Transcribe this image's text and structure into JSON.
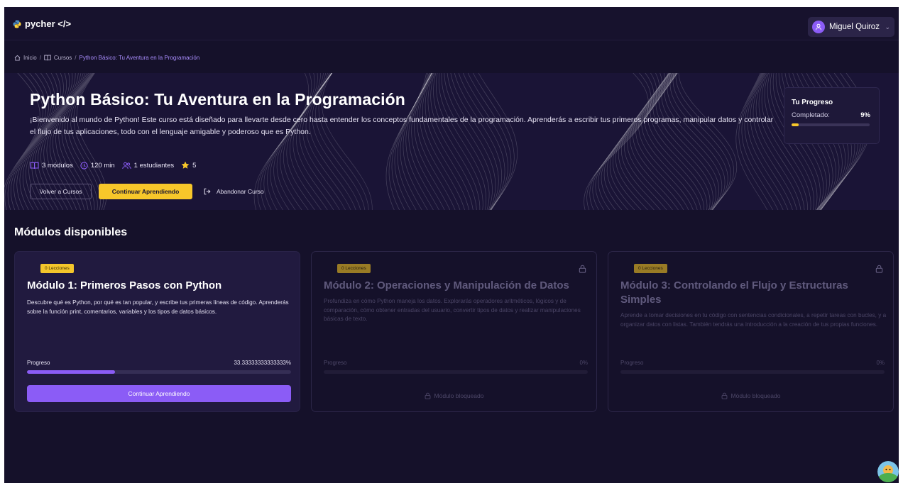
{
  "header": {
    "logo_text": "pycher </>",
    "user_name": "Miguel Quiroz"
  },
  "breadcrumb": {
    "home": "Inicio",
    "courses": "Cursos",
    "current": "Python Básico: Tu Aventura en la Programación",
    "separator": "/"
  },
  "hero": {
    "title": "Python Básico: Tu Aventura en la Programación",
    "description": "¡Bienvenido al mundo de Python! Este curso está diseñado para llevarte desde cero hasta entender los conceptos fundamentales de la programación. Aprenderás a escribir tus primeros programas, manipular datos y controlar el flujo de tus aplicaciones, todo con el lenguaje amigable y poderoso que es Python.",
    "stats": {
      "modules": "3 módulos",
      "duration": "120 min",
      "students": "1 estudiantes",
      "rating": "5"
    },
    "back_button": "Volver a Cursos",
    "continue_button": "Continuar Aprendiendo",
    "abandon_button": "Abandonar Curso"
  },
  "progress_card": {
    "title": "Tu Progreso",
    "label": "Completado:",
    "value": "9%",
    "fraction": 0.09
  },
  "section_title": "Módulos disponibles",
  "modules": [
    {
      "badge": "0 Lecciones",
      "title": "Módulo 1: Primeros Pasos con Python",
      "description": "Descubre qué es Python, por qué es tan popular, y escribe tus primeras líneas de código. Aprenderás sobre la función print, comentarios, variables y los tipos de datos básicos.",
      "progress_label": "Progreso",
      "progress_value": "33.33333333333333%",
      "progress_fraction": 0.3333,
      "cta": "Continuar Aprendiendo",
      "locked": false
    },
    {
      "badge": "0 Lecciones",
      "title": "Módulo 2: Operaciones y Manipulación de Datos",
      "description": "Profundiza en cómo Python maneja los datos. Explorarás operadores aritméticos, lógicos y de comparación, cómo obtener entradas del usuario, convertir tipos de datos y realizar manipulaciones básicas de texto.",
      "progress_label": "Progreso",
      "progress_value": "0%",
      "progress_fraction": 0,
      "locked_text": "Módulo bloqueado",
      "locked": true
    },
    {
      "badge": "0 Lecciones",
      "title": "Módulo 3: Controlando el Flujo y Estructuras Simples",
      "description": "Aprende a tomar decisiones en tu código con sentencias condicionales, a repetir tareas con bucles, y a organizar datos con listas. También tendrás una introducción a la creación de tus propias funciones.",
      "progress_label": "Progreso",
      "progress_value": "0%",
      "progress_fraction": 0,
      "locked_text": "Módulo bloqueado",
      "locked": true
    }
  ],
  "colors": {
    "background": "#15112a",
    "accent_purple": "#8b5cf6",
    "accent_yellow": "#f7c72a"
  }
}
